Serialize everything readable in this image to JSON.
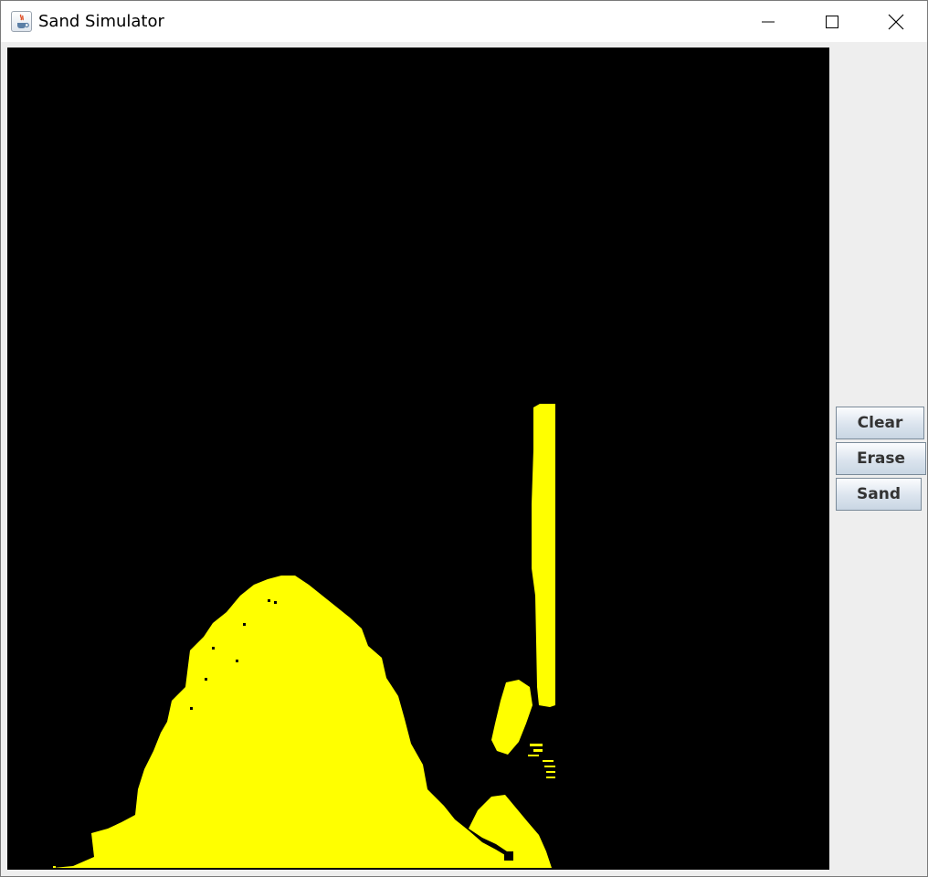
{
  "window": {
    "title": "Sand Simulator"
  },
  "title_bar_controls": {
    "minimize_icon": "minimize-icon",
    "maximize_icon": "maximize-icon",
    "close_icon": "close-icon"
  },
  "sidebar": {
    "buttons": [
      {
        "label": "Clear"
      },
      {
        "label": "Erase"
      },
      {
        "label": "Sand"
      }
    ]
  },
  "canvas": {
    "background_color": "#000000",
    "sand_color": "#ffff00"
  }
}
